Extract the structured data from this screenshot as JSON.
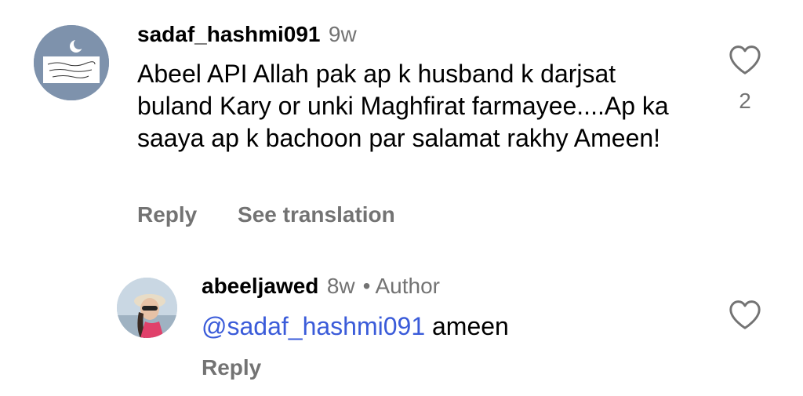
{
  "comments": [
    {
      "username": "sadaf_hashmi091",
      "time": "9w",
      "text": "Abeel API Allah pak ap k husband k darjsat buland Kary or unki Maghfirat farmayee....Ap ka saaya ap k bachoon par salamat rakhy Ameen!",
      "reply_label": "Reply",
      "translation_label": "See translation",
      "like_count": "2",
      "like_icon": "heart-outline-icon"
    },
    {
      "username": "abeeljawed",
      "time": "8w",
      "separator": "•",
      "badge": "Author",
      "mention": "@sadaf_hashmi091",
      "text": " ameen",
      "reply_label": "Reply",
      "like_icon": "heart-outline-icon"
    }
  ],
  "colors": {
    "secondary_text": "#737373",
    "mention": "#3a5bd9",
    "primary_text": "#000000"
  }
}
